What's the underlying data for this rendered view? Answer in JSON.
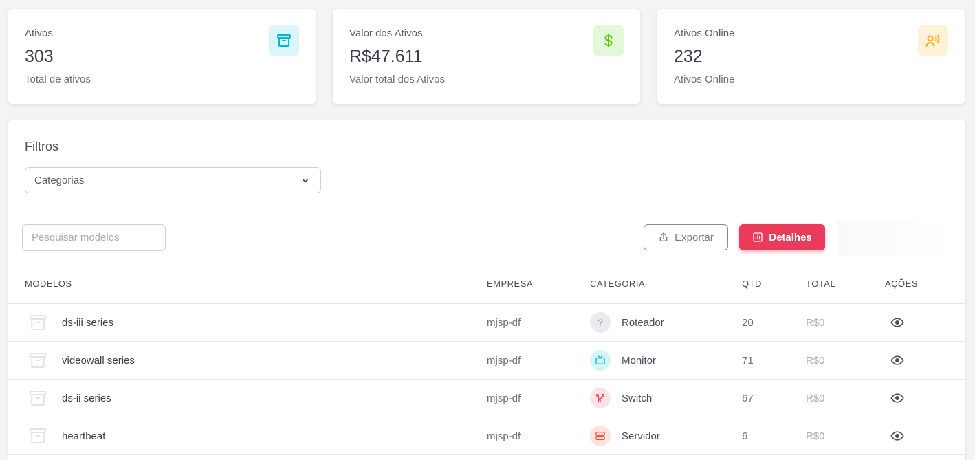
{
  "stats": [
    {
      "label": "Ativos",
      "value": "303",
      "subtitle": "Total de ativos",
      "icon": "archive-icon",
      "icon_bg": "#dbf6fb",
      "icon_color": "#00bad1"
    },
    {
      "label": "Valor dos Ativos",
      "value": "R$47.611",
      "subtitle": "Valor total dos Ativos",
      "icon": "dollar-icon",
      "icon_bg": "#e2f8d8",
      "icon_color": "#56ca00"
    },
    {
      "label": "Ativos Online",
      "value": "232",
      "subtitle": "Ativos Online",
      "icon": "user-voice-icon",
      "icon_bg": "#fff2d9",
      "icon_color": "#ffab00"
    }
  ],
  "filters": {
    "title": "Filtros",
    "category_select": "Categorias"
  },
  "toolbar": {
    "search_placeholder": "Pesquisar modelos",
    "export_label": "Exportar",
    "details_label": "Detalhes"
  },
  "table": {
    "headers": {
      "model": "MODELOS",
      "company": "EMPRESA",
      "category": "CATEGORIA",
      "qty": "QTD",
      "total": "TOTAL",
      "actions": "AÇÕES"
    },
    "rows": [
      {
        "model": "ds-iii series",
        "company": "mjsp-df",
        "category": "Roteador",
        "category_icon": "question-icon",
        "badge_bg": "#ebebee",
        "badge_color": "#8a8896",
        "qty": "20",
        "total": "R$0"
      },
      {
        "model": "videowall series",
        "company": "mjsp-df",
        "category": "Monitor",
        "category_icon": "tv-icon",
        "badge_bg": "#d4f5fa",
        "badge_color": "#00bad1",
        "qty": "71",
        "total": "R$0"
      },
      {
        "model": "ds-ii series",
        "company": "mjsp-df",
        "category": "Switch",
        "category_icon": "network-icon",
        "badge_bg": "#fde2e7",
        "badge_color": "#ea3b5a",
        "qty": "67",
        "total": "R$0"
      },
      {
        "model": "heartbeat",
        "company": "mjsp-df",
        "category": "Servidor",
        "category_icon": "server-icon",
        "badge_bg": "#fde3dc",
        "badge_color": "#ff4c30",
        "qty": "6",
        "total": "R$0"
      }
    ]
  }
}
